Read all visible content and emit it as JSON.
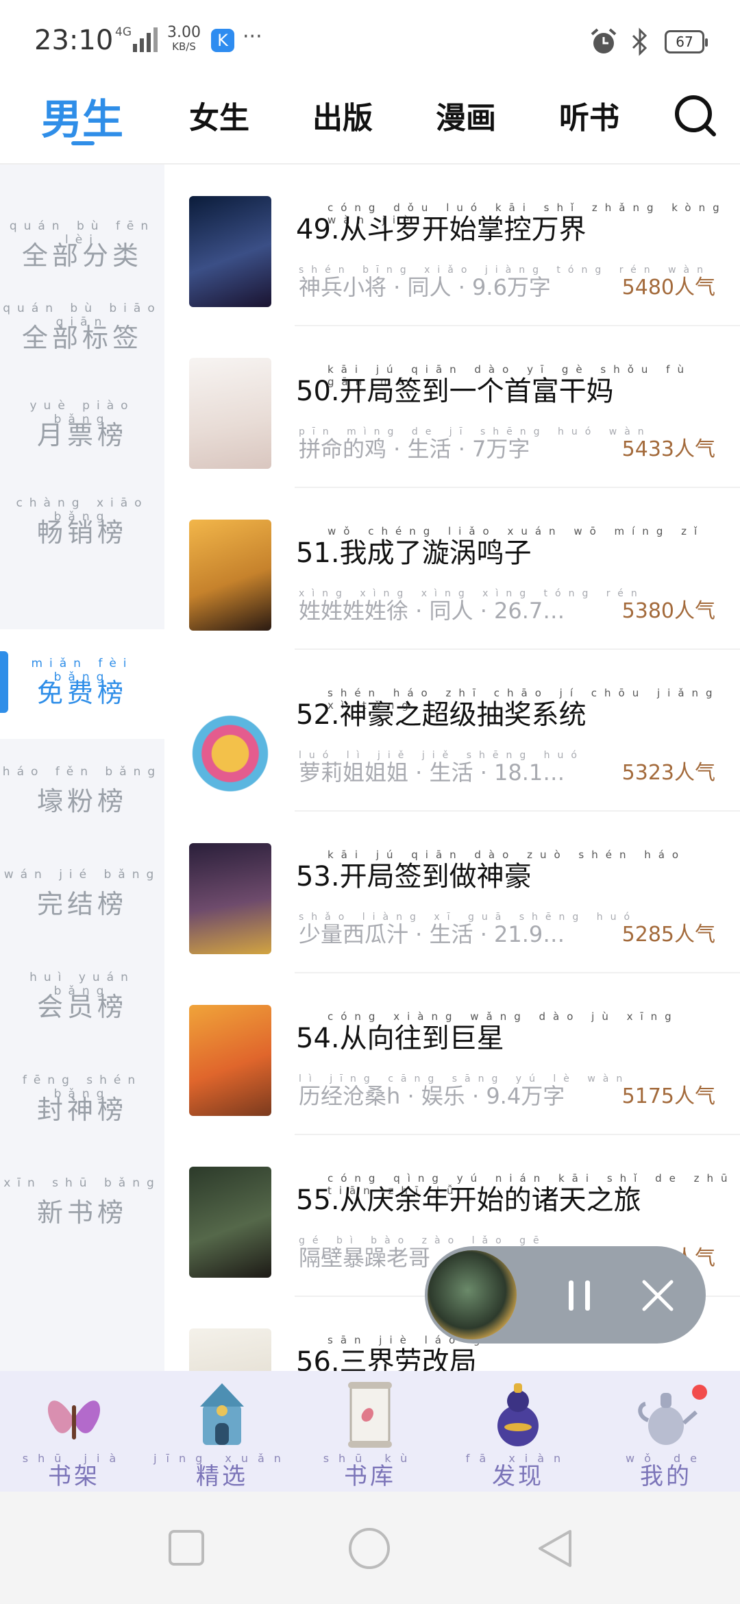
{
  "status_bar": {
    "time": "23:10",
    "network": "4G",
    "speed_value": "3.00",
    "speed_unit": "KB/S",
    "app_badge": "K",
    "more": "···",
    "battery": "67"
  },
  "top_tabs": {
    "items": [
      "男生",
      "女生",
      "出版",
      "漫画",
      "听书"
    ],
    "active": "男生"
  },
  "sidebar": {
    "items": [
      {
        "label": "全部分类",
        "pinyin": "quán bù fēn lèi"
      },
      {
        "label": "全部标签",
        "pinyin": "quán bù biāo qiān"
      },
      {
        "label": "月票榜",
        "pinyin": "yuè piào bǎng"
      },
      {
        "label": "畅销榜",
        "pinyin": "chàng xiāo bǎng"
      },
      {
        "label": "免费榜",
        "pinyin": "miǎn fèi bǎng"
      },
      {
        "label": "壕粉榜",
        "pinyin": "háo fěn bǎng"
      },
      {
        "label": "完结榜",
        "pinyin": "wán jié bǎng"
      },
      {
        "label": "会员榜",
        "pinyin": "huì yuán bǎng"
      },
      {
        "label": "封神榜",
        "pinyin": "fēng shén bǎng"
      },
      {
        "label": "新书榜",
        "pinyin": "xīn shū bǎng"
      }
    ],
    "active_index": 4
  },
  "books": [
    {
      "title": "49.从斗罗开始掌控万界",
      "title_pinyin": "cóng dǒu luó kāi shǐ zhǎng kòng wàn jiè",
      "meta": "神兵小将 · 同人 · 9.6万字",
      "meta_pinyin": "shén bīng xiǎo jiàng tóng rén wàn",
      "popularity": "5480人气"
    },
    {
      "title": "50.开局签到一个首富干妈",
      "title_pinyin": "kāi jú qiān dào yī gè shǒu fù gān mā",
      "meta": "拼命的鸡 · 生活 · 7万字",
      "meta_pinyin": "pīn mìng de jī shēng huó wàn",
      "popularity": "5433人气"
    },
    {
      "title": "51.我成了漩涡鸣子",
      "title_pinyin": "wǒ chéng liǎo xuán wō míng zǐ",
      "meta": "姓姓姓姓徐 · 同人 · 26.7…",
      "meta_pinyin": "xìng xìng xìng xìng tóng rén",
      "popularity": "5380人气"
    },
    {
      "title": "52.神豪之超级抽奖系统",
      "title_pinyin": "shén háo zhī chāo jí chōu jiǎng xì tǒng",
      "meta": "萝莉姐姐姐 · 生活 · 18.1…",
      "meta_pinyin": "luó lì jiě jiě shēng huó",
      "popularity": "5323人气"
    },
    {
      "title": "53.开局签到做神豪",
      "title_pinyin": "kāi jú qiān dào zuò shén háo",
      "meta": "少量西瓜汁 · 生活 · 21.9…",
      "meta_pinyin": "shǎo liàng xī guā shēng huó",
      "popularity": "5285人气"
    },
    {
      "title": "54.从向往到巨星",
      "title_pinyin": "cóng xiàng wǎng dào jù xīng",
      "meta": "历经沧桑h · 娱乐 · 9.4万字",
      "meta_pinyin": "lì jīng cāng sāng yú lè wàn",
      "popularity": "5175人气"
    },
    {
      "title": "55.从庆余年开始的诸天之旅",
      "title_pinyin": "cóng qìng yú nián kāi shǐ de zhū tiān zhī lǚ",
      "meta": "隔壁暴躁老哥",
      "meta_pinyin": "gé bì bào zào lǎo gē",
      "popularity": "人气"
    },
    {
      "title": "56.三界劳改局",
      "title_pinyin": "sān jiè láo gǎi",
      "meta": "",
      "meta_pinyin": "",
      "popularity": ""
    }
  ],
  "bottom_nav": {
    "items": [
      {
        "label": "书架",
        "pinyin": "shū jià",
        "icon": "butterfly-icon"
      },
      {
        "label": "精选",
        "pinyin": "jīng xuǎn",
        "icon": "tower-icon"
      },
      {
        "label": "书库",
        "pinyin": "shū kù",
        "icon": "scroll-icon"
      },
      {
        "label": "发现",
        "pinyin": "fā xiàn",
        "icon": "gourd-icon"
      },
      {
        "label": "我的",
        "pinyin": "wǒ de",
        "icon": "teapot-icon"
      }
    ],
    "active": "书库"
  },
  "colors": {
    "accent": "#2f8ee8",
    "popularity": "#a36a3b",
    "bottom_nav_bg": "#ececf9"
  }
}
